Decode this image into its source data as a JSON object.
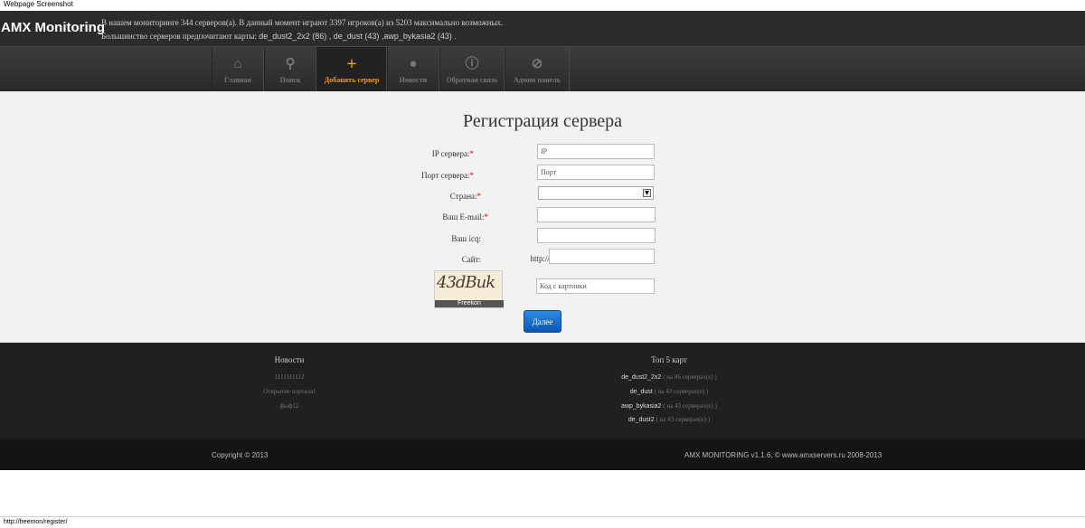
{
  "screenshot_label": "Webpage Screenshot",
  "header": {
    "brand": "AMX Monitoring",
    "stats_line1": "В нашем мониторинге 344 серверов(а). В данный момент играют 3397 игроков(а) из 5203 максимально возможных.",
    "stats_line2_prefix": "Большинство серверов предпочитают карты: ",
    "stats_line2_maps": "de_dust2_2x2 (86) , de_dust (43) ,awp_bykasia2 (43) ."
  },
  "nav": [
    {
      "label": "Главная",
      "icon": "home-icon"
    },
    {
      "label": "Поиск",
      "icon": "search-icon"
    },
    {
      "label": "Добавить сервер",
      "icon": "plus-icon"
    },
    {
      "label": "Новости",
      "icon": "chat-icon"
    },
    {
      "label": "Обратная связь",
      "icon": "info-icon"
    },
    {
      "label": "Админ панель",
      "icon": "eye-off-icon"
    }
  ],
  "form": {
    "title": "Регистрация сервера",
    "ip_label": "IP сервера:",
    "ip_placeholder": "IP",
    "port_label": "Порт сервера:",
    "port_placeholder": "Порт",
    "country_label": "Страна:",
    "email_label": "Ваш E-mail:",
    "icq_label": "Ваш icq:",
    "site_label": "Сайт:",
    "site_prefix": "http://",
    "captcha_text": "43dBuk",
    "captcha_footer": "Freekon",
    "captcha_placeholder": "Код с картинки",
    "submit": "Далее",
    "required_mark": "*"
  },
  "footer": {
    "news_title": "Новости",
    "news_items": [
      "1111111112",
      "Открытие портала!",
      "фыф12"
    ],
    "maps_title": "Топ 5 карт",
    "maps": [
      {
        "name": "de_dust2_2x2",
        "count": "( на 86 серверах(е) )"
      },
      {
        "name": "de_dust",
        "count": "( на 43 серверах(е) )"
      },
      {
        "name": "awp_bykasia2",
        "count": "( на 43 серверах(е) )"
      },
      {
        "name": "de_dust2",
        "count": "( на 43 серверах(е) )"
      }
    ]
  },
  "bottom": {
    "copyright": "Copyright © 2013",
    "version": "AMX MONITORING v1.1.6, © www.amxservers.ru 2008-2013"
  },
  "status_url": "http://freemon/register/",
  "colors": {
    "accent": "#f39c12",
    "button": "#0a55b8",
    "required": "#dd0000"
  }
}
